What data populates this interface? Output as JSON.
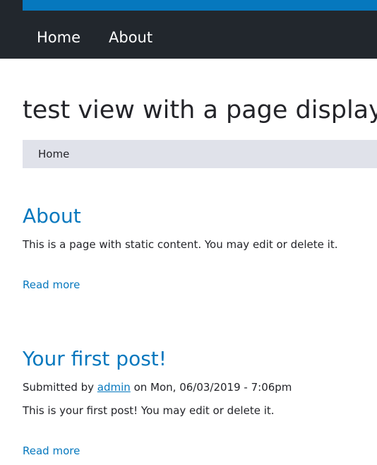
{
  "colors": {
    "header_bg": "#22272d",
    "brand_blue": "#0678be",
    "breadcrumb_bg": "#e0e2ea",
    "text": "#232429",
    "link": "#0678be"
  },
  "main_nav": {
    "items": [
      {
        "label": "Home"
      },
      {
        "label": "About"
      }
    ]
  },
  "page_title": "test view with a page display",
  "breadcrumb": {
    "items": [
      {
        "label": "Home"
      }
    ]
  },
  "nodes": [
    {
      "title": "About",
      "body": "This is a page with static content. You may edit or delete it.",
      "read_more": "Read more"
    },
    {
      "title": "Your first post!",
      "submitted_prefix": "Submitted by",
      "author": "admin",
      "submitted_suffix": "on Mon, 06/03/2019 - 7:06pm",
      "body": "This is your first post! You may edit or delete it.",
      "read_more": "Read more"
    }
  ]
}
